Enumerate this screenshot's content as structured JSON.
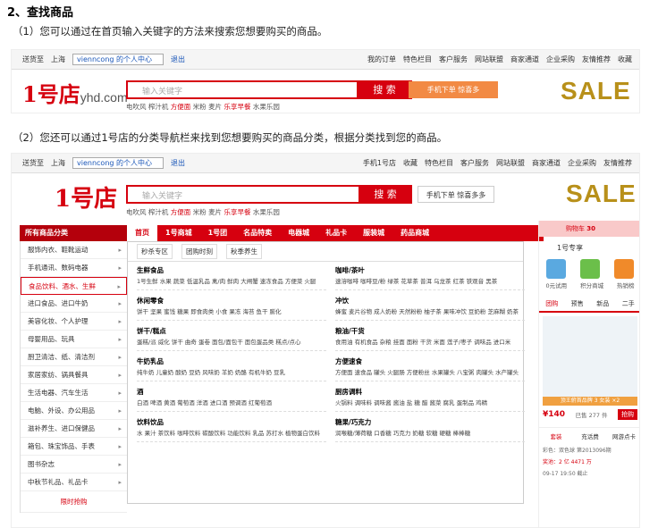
{
  "heading": "2、查找商品",
  "para1": "（1）您可以通过在首页输入关键字的方法来搜索您想要购买的商品。",
  "para2": "（2）您还可以通过1号店的分类导航栏来找到您想要购买的商品分类，根据分类找到您的商品。",
  "shot1": {
    "topbar": {
      "deliver": "送货至",
      "city": "上海",
      "user": "vienncong 的个人中心",
      "logout": "退出",
      "links": [
        "我的订单",
        "特色栏目",
        "客户服务",
        "网站联盟",
        "商家通道",
        "企业采购",
        "友情推荐",
        "收藏"
      ]
    },
    "logo_text": "1号店",
    "logo_domain": "yhd.com",
    "search_placeholder": "输入关键字",
    "search_btn": "搜 索",
    "hot": [
      "电吹风",
      "榨汁机",
      "方便面",
      "米粉",
      "麦片",
      "乐享早餐",
      "水果乐园"
    ],
    "mobile": "手机下单 惊喜多",
    "sale": "SALE"
  },
  "shot2": {
    "topbar": {
      "deliver": "送货至",
      "city": "上海",
      "user": "vienncong 的个人中心",
      "logout": "退出",
      "links": [
        "手机1号店",
        "收藏",
        "特色栏目",
        "客户服务",
        "网站联盟",
        "商家通道",
        "企业采购",
        "友情推荐"
      ]
    },
    "logo_text": "1号店",
    "search_placeholder": "输入关键字",
    "search_btn": "搜 索",
    "mobile": "手机下单 惊喜多多",
    "hot": [
      "电吹风",
      "榨汁机",
      "方便面",
      "米粉",
      "麦片",
      "乐享早餐",
      "水果乐园"
    ],
    "sale": "SALE",
    "nav": {
      "cat": "所有商品分类",
      "items": [
        "首页",
        "1号商城",
        "1号团",
        "名品特卖",
        "电器城",
        "礼品卡",
        "服装城",
        "药品商城"
      ]
    },
    "side": [
      "服饰内衣、鞋靴运动",
      "手机通讯、数码电器",
      "食品饮料、酒水、生鲜",
      "进口食品、进口牛奶",
      "美容化妆、个人护理",
      "母婴用品、玩具",
      "厨卫清洁、纸、清洁剂",
      "家居家纺、锅具餐具",
      "生活电器、汽车生活",
      "电脑、外设、办公用品",
      "滋补养生、进口保健品",
      "箱包、珠宝饰品、手表",
      "图书杂志",
      "中秋节礼品、礼品卡"
    ],
    "side_bottom": "限时抢购",
    "tabs": [
      "秒杀专区",
      "团购时刻",
      "秋季养生"
    ],
    "left_groups": [
      {
        "t": "生鲜食品",
        "items": "1号生鲜  水果  蔬菜  低温乳品  禽/肉  鲜肉  大闸蟹  速冻食品  方便菜  火腿"
      },
      {
        "t": "休闲零食",
        "items": "饼干  坚果  蜜饯  糖果  即食肉类  小食  果冻  海苔  鱼干  膨化"
      },
      {
        "t": "饼干/糕点",
        "items": "蛋糕/派  威化  饼干  曲奇  蛋卷  面包/面包干  面包蛋品类  糕点/点心"
      },
      {
        "t": "牛奶乳品",
        "items": "纯牛奶  儿童奶  酸奶  豆奶  风味奶  羊奶  奶酪  有机牛奶  豆乳"
      },
      {
        "t": "酒",
        "items": "白酒  啤酒  黄酒  葡萄酒  洋酒  进口酒  预调酒  红葡萄酒"
      },
      {
        "t": "饮料饮品",
        "items": "水  果汁  茶饮料  咖啡饮料  碳酸饮料  功能饮料  乳品  苏打水  植物蛋白饮料"
      }
    ],
    "right_groups": [
      {
        "t": "咖啡/茶叶",
        "items": "速溶咖啡  咖啡豆/粉  绿茶  花草茶  普洱  乌龙茶  红茶  铁观音  黑茶"
      },
      {
        "t": "冲饮",
        "items": "蜂蜜  麦片谷物  成人奶粉  天然粉粉  柚子茶  果味冲饮  豆奶粉  芝麻糊  奶茶"
      },
      {
        "t": "粮油/干货",
        "items": "食用油  有机食品  杂粮  挂面  面粉  干货  米面  莲子/枣子  调味品  进口米"
      },
      {
        "t": "方便速食",
        "items": "方便面  速食品  罐头  火腿肠  方便粉丝  水果罐头  八宝粥  肉罐头  水产罐头"
      },
      {
        "t": "厨房调料",
        "items": "火锅料  调味料  调味酱  酱油  盐  糖  醋  酱菜  腐乳  蛋制品  鸡精"
      },
      {
        "t": "糖果/巧克力",
        "items": "润喉糖/薄荷糖  口香糖  巧克力  奶糖  软糖  硬糖  棒棒糖"
      }
    ],
    "cart": "购物车",
    "cart_count": "30",
    "r_title": "1号专享",
    "icon_labels": [
      "0元试用",
      "积分商城",
      "热销榜"
    ],
    "r_tabs": [
      "团购",
      "预售",
      "新品",
      "二手"
    ],
    "baby_caption": "顶王俯首品牌 3 女装 ×2",
    "price": "¥140",
    "sold": "已售 277 件",
    "buy_btn": "抢购",
    "r_tabs2": [
      "套装",
      "充话费",
      "网游点卡"
    ],
    "color": "彩色：双色球",
    "count": "第2013096期",
    "prize": "奖池：2 亿 4471 万",
    "date": "09-17 19:50 截止"
  }
}
